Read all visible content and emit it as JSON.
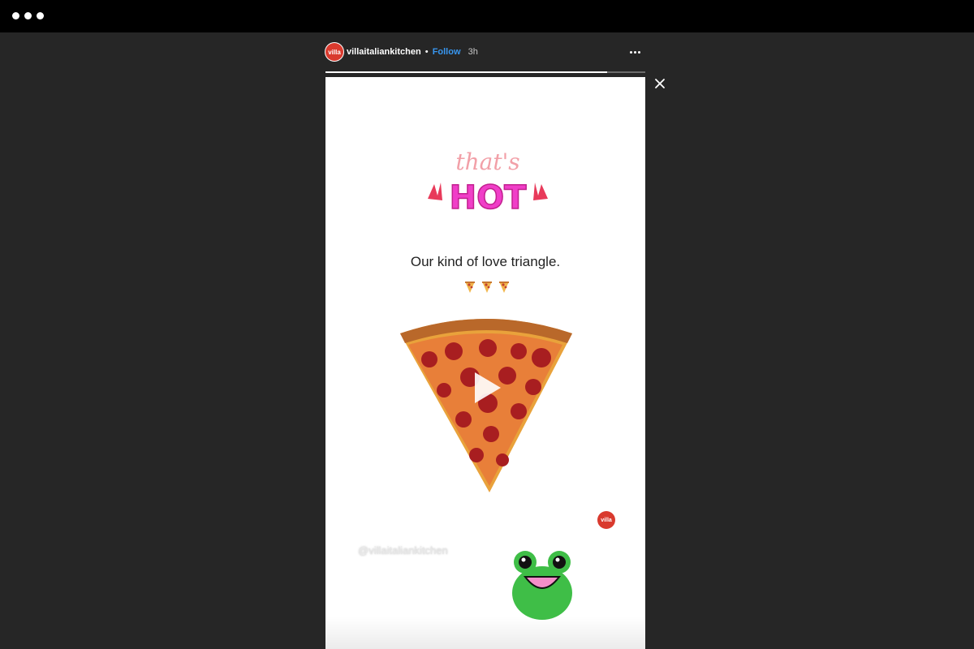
{
  "header": {
    "avatar_text": "villa",
    "username": "villaitaliankitchen",
    "separator": "•",
    "follow_label": "Follow",
    "time": "3h"
  },
  "progress": {
    "fraction": 0.88
  },
  "story": {
    "caption": "Our kind of love triangle.",
    "badge_text": "villa",
    "watermark": "@villaitaliankitchen"
  },
  "colors": {
    "accent_link": "#3897f0",
    "brand_red": "#d93a2e",
    "background": "#262626"
  },
  "icons": [
    "more-options-icon",
    "close-icon",
    "play-icon",
    "window-menu-icon"
  ]
}
